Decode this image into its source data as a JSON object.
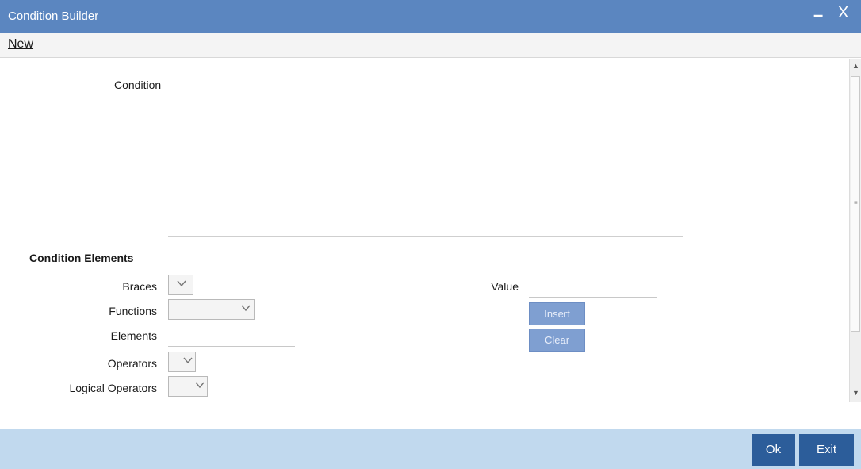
{
  "window": {
    "title": "Condition Builder",
    "minimize_glyph": "–",
    "close_glyph": "X"
  },
  "menu": {
    "new_label": "New"
  },
  "condition": {
    "label": "Condition",
    "value": ""
  },
  "elements_section": {
    "title": "Condition Elements",
    "braces_label": "Braces",
    "functions_label": "Functions",
    "elements_label": "Elements",
    "operators_label": "Operators",
    "logical_operators_label": "Logical Operators",
    "value_label": "Value",
    "elements_value": "",
    "value_value": "",
    "insert_label": "Insert",
    "clear_label": "Clear"
  },
  "footer": {
    "ok_label": "Ok",
    "exit_label": "Exit"
  },
  "colors": {
    "titlebar": "#5b86c0",
    "footer": "#c1d9ee",
    "primary_button": "#2c5d9a",
    "secondary_button": "#7f9fd1"
  }
}
